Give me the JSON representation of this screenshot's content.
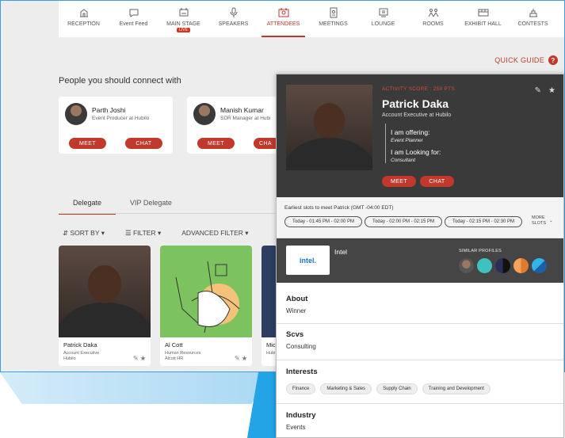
{
  "nav": [
    {
      "label": "RECEPTION",
      "icon": "reception-icon"
    },
    {
      "label": "Event Feed",
      "icon": "feed-icon"
    },
    {
      "label": "MAIN STAGE",
      "icon": "stage-icon",
      "badge": "LIVE"
    },
    {
      "label": "SPEAKERS",
      "icon": "mic-icon"
    },
    {
      "label": "ATTENDEES",
      "icon": "attendees-icon",
      "active": true
    },
    {
      "label": "MEETINGS",
      "icon": "meetings-icon"
    },
    {
      "label": "LOUNGE",
      "icon": "lounge-icon"
    },
    {
      "label": "ROOMS",
      "icon": "rooms-icon"
    },
    {
      "label": "EXHIBIT HALL",
      "icon": "exhibit-icon"
    },
    {
      "label": "CONTESTS",
      "icon": "contests-icon"
    }
  ],
  "quick_guide": "QUICK GUIDE",
  "connect_title": "People you should connect with",
  "connect_cards": [
    {
      "name": "Parth Joshi",
      "role": "Event Producer at Hubilo",
      "meet": "MEET",
      "chat": "CHAT"
    },
    {
      "name": "Manish Kumar",
      "role": "SDR Manager at Hubi",
      "meet": "MEET",
      "chat": "CHA"
    }
  ],
  "tabs": [
    "Delegate",
    "VIP Delegate"
  ],
  "filters": {
    "sort": "SORT BY",
    "filter": "FILTER",
    "advanced": "ADVANCED FILTER"
  },
  "people": [
    {
      "name": "Patrick Daka",
      "role": "Account Executive",
      "company": "Hubilo"
    },
    {
      "name": "Al Cott",
      "role": "Human Resources",
      "company": "Alcott HR"
    },
    {
      "name": "Mic",
      "role": "",
      "company": "Hubi"
    }
  ],
  "profile": {
    "activity": "ACTIVITY SCORE : 259 PTS",
    "name": "Patrick Daka",
    "role": "Account Executive at Hubilo",
    "offering_label": "I am offering:",
    "offering_value": "Event Planner",
    "looking_label": "I am Looking for:",
    "looking_value": "Consultant",
    "meet": "MEET",
    "chat": "CHAT",
    "slots_title": "Earliest slots to meet Patrick (GMT -04:00 EDT)",
    "slots": [
      "Today - 01:45 PM - 02:00 PM",
      "Today - 02:00 PM - 02:15 PM",
      "Today - 02:15 PM - 02:30 PM"
    ],
    "more_slots_1": "MORE",
    "more_slots_2": "SLOTS",
    "company": "Intel",
    "company_logo": "intel.",
    "similar_title": "SIMILAR PROFILES",
    "about_h": "About",
    "about_v": "Winner",
    "scvs_h": "Scvs",
    "scvs_v": "Consulting",
    "interests_h": "Interests",
    "interests": [
      "Finance",
      "Marketing & Sales",
      "Supply Chain",
      "Training and Development"
    ],
    "industry_h": "Industry",
    "industry_v": "Events"
  },
  "colors": {
    "accent": "#c0392b",
    "panel_dark": "#3a3a3a",
    "brand_blue": "#22a4e6"
  }
}
